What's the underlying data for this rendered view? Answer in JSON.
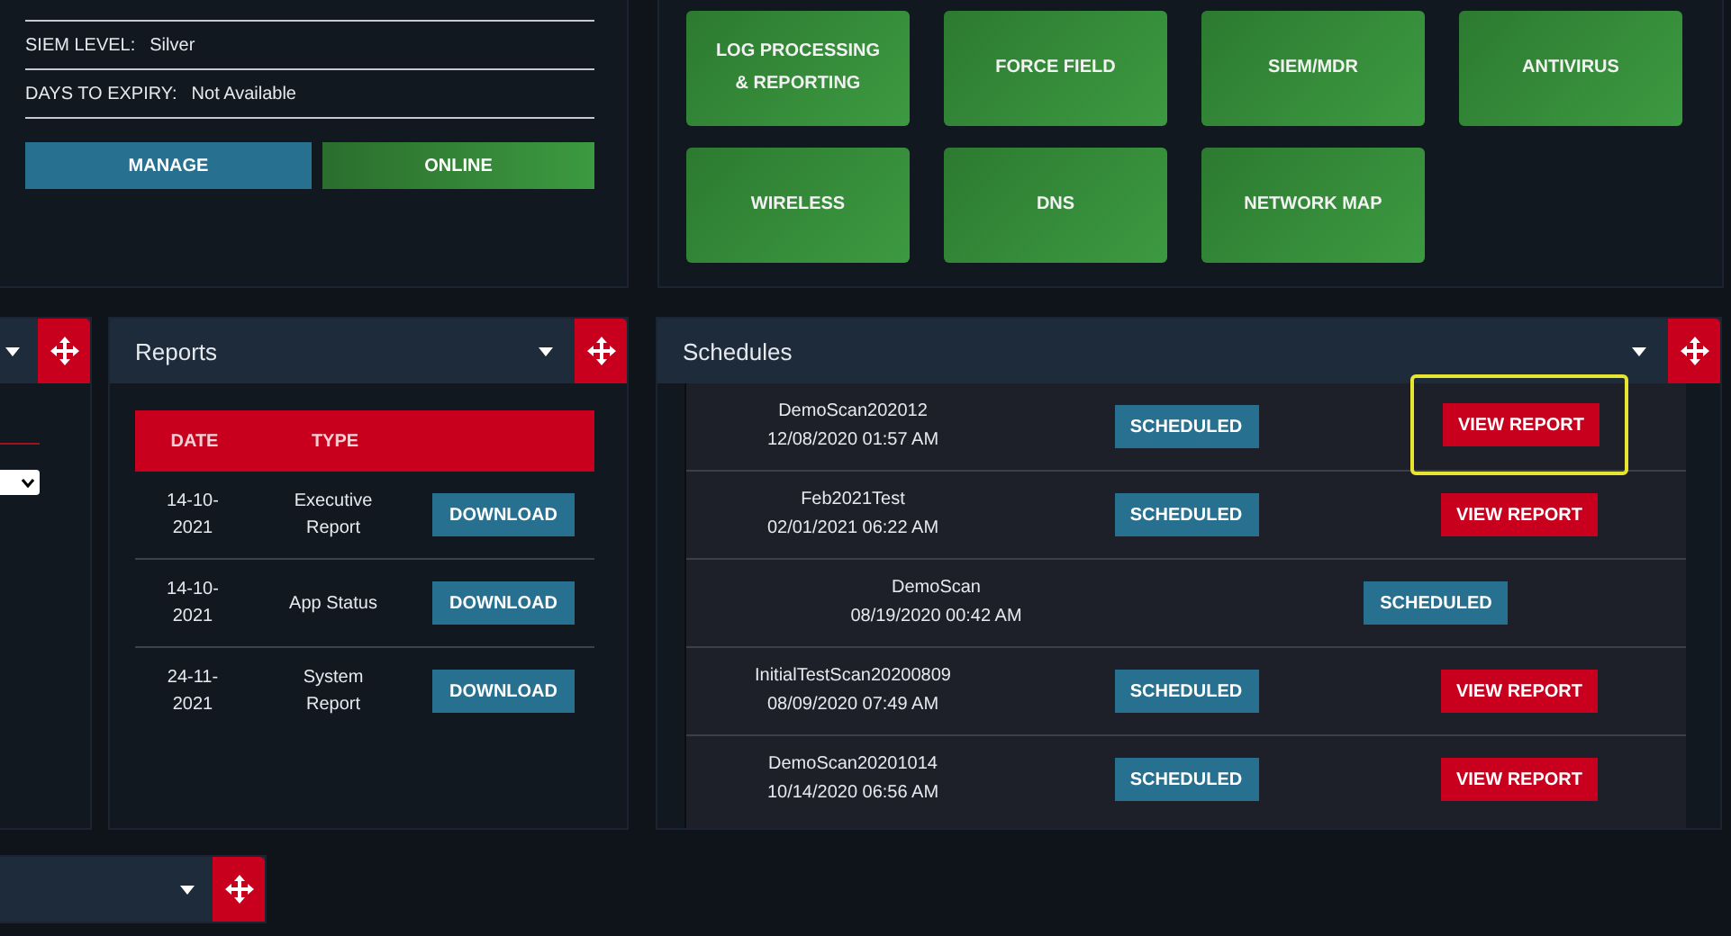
{
  "license": {
    "fields": [
      {
        "label": "SIEM LEVEL:",
        "value": "Silver"
      },
      {
        "label": "DAYS TO EXPIRY:",
        "value": "Not Available"
      }
    ],
    "buttons": [
      {
        "label": "MANAGE",
        "kind": "manage"
      },
      {
        "label": "ONLINE",
        "kind": "online"
      }
    ]
  },
  "modules": [
    "LOG PROCESSING & REPORTING",
    "FORCE FIELD",
    "SIEM/MDR",
    "ANTIVIRUS",
    "WIRELESS",
    "DNS",
    "NETWORK MAP"
  ],
  "reports": {
    "title": "Reports",
    "columns": [
      "DATE",
      "TYPE"
    ],
    "rows": [
      {
        "date": "14-10-2021",
        "type": "Executive Report",
        "action": "DOWNLOAD"
      },
      {
        "date": "14-10-2021",
        "type": "App Status",
        "action": "DOWNLOAD"
      },
      {
        "date": "24-11-2021",
        "type": "System Report",
        "action": "DOWNLOAD"
      }
    ]
  },
  "schedules": {
    "title": "Schedules",
    "rows": [
      {
        "name": "DemoScan202012",
        "time": "12/08/2020 01:57 AM",
        "status": "SCHEDULED",
        "report": "VIEW REPORT",
        "highlighted": true
      },
      {
        "name": "Feb2021Test",
        "time": "02/01/2021 06:22 AM",
        "status": "SCHEDULED",
        "report": "VIEW REPORT",
        "highlighted": false
      },
      {
        "name": "DemoScan",
        "time": "08/19/2020 00:42 AM",
        "status": "SCHEDULED",
        "highlighted": false
      },
      {
        "name": "InitialTestScan20200809",
        "time": "08/09/2020 07:49 AM",
        "status": "SCHEDULED",
        "report": "VIEW REPORT",
        "highlighted": false
      },
      {
        "name": "DemoScan20201014",
        "time": "10/14/2020 06:56 AM",
        "status": "SCHEDULED",
        "report": "VIEW REPORT",
        "highlighted": false
      }
    ]
  }
}
